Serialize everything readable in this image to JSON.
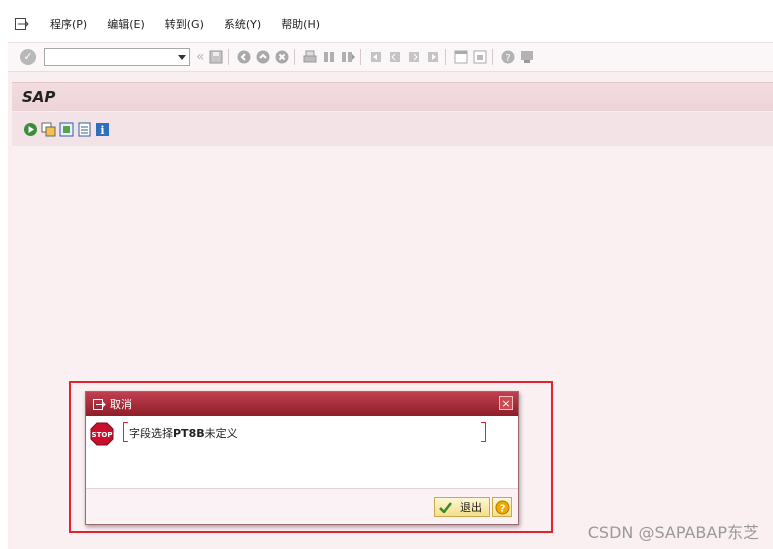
{
  "menu": {
    "items": [
      {
        "label": "程序(P)"
      },
      {
        "label": "编辑(E)"
      },
      {
        "label": "转到(G)"
      },
      {
        "label": "系统(Y)"
      },
      {
        "label": "帮助(H)"
      }
    ]
  },
  "toolbar": {
    "command_value": "",
    "chevron": "«"
  },
  "titlebar": {
    "title": "SAP"
  },
  "dialog": {
    "title": "取消",
    "message_prefix": "字段选择",
    "message_code": "PT8B",
    "message_suffix": "未定义",
    "exit_label": "退出",
    "close_glyph": "×"
  },
  "watermark": {
    "text": "CSDN @SAPABAP东芝"
  },
  "colors": {
    "dialog_header": "#a82a37",
    "highlight_border": "#e0242b",
    "stop_red": "#c8102e",
    "button_yellow": "#f3df8c"
  }
}
